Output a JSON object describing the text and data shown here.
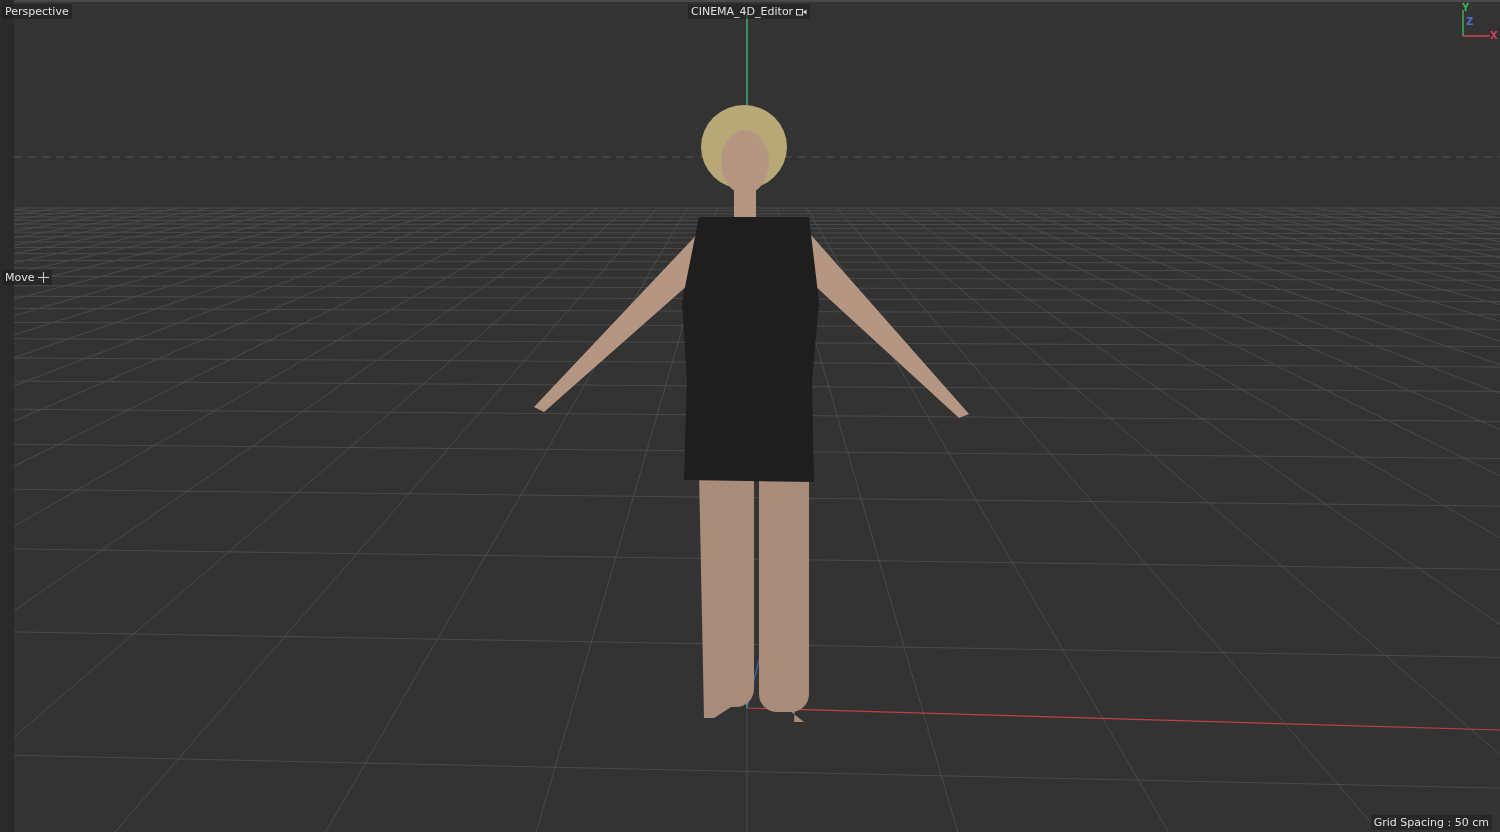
{
  "viewport": {
    "camera": "Perspective",
    "camera_name": "CINEMA_4D_Editor",
    "tool": "Move",
    "grid_spacing": "Grid Spacing : 50 cm"
  },
  "axis_gizmo": [
    {
      "kind": "y",
      "label": "Y",
      "color": "#3fae5a"
    },
    {
      "kind": "z",
      "label": "Z",
      "color": "#4a6fd0"
    },
    {
      "kind": "x",
      "label": "X",
      "color": "#d04050"
    }
  ]
}
